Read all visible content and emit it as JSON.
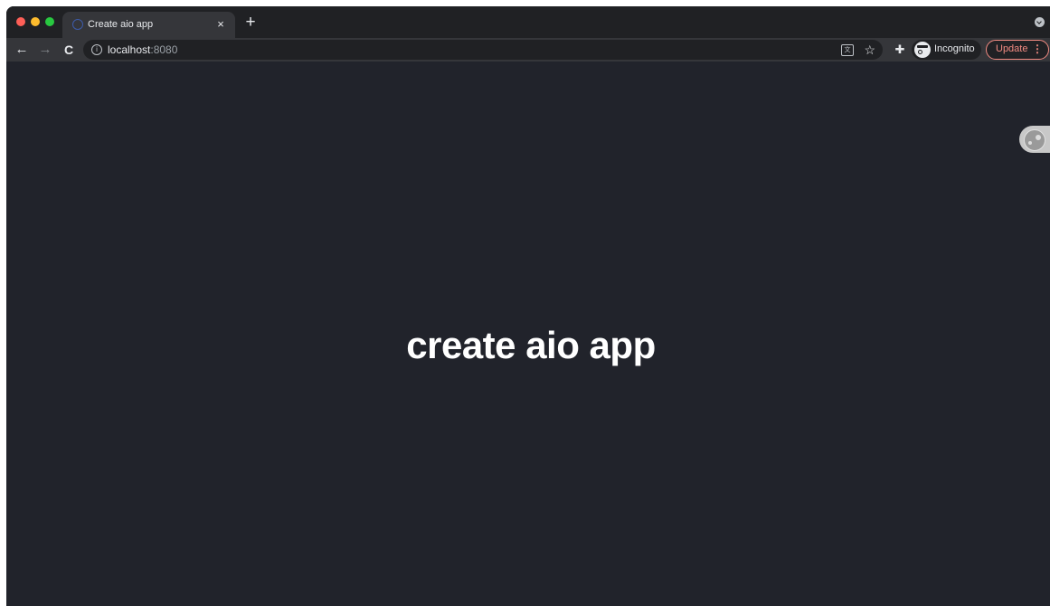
{
  "browser": {
    "tab": {
      "title": "Create aio app",
      "close_glyph": "×",
      "favicon_icon": "aio-logo-icon"
    },
    "new_tab_glyph": "+",
    "toolbar": {
      "back_glyph": "←",
      "forward_glyph": "→",
      "reload_glyph": "C",
      "info_glyph": "i",
      "url_host": "localhost",
      "url_port": ":8080",
      "translate_glyph": "文",
      "star_glyph": "☆",
      "extensions_glyph": "✚",
      "incognito_label": "Incognito",
      "update_label": "Update",
      "update_menu_glyph": "⋮"
    },
    "colors": {
      "frame": "#202124",
      "toolbar": "#35363a",
      "page_background": "#21232b",
      "update_accent": "#f28b82"
    }
  },
  "page": {
    "heading": "create aio app"
  }
}
